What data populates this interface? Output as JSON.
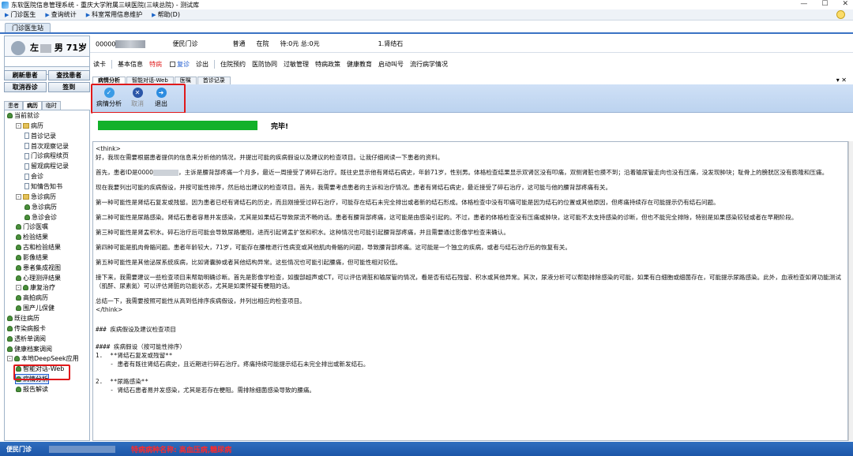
{
  "window": {
    "title": "东软医院信息管理系统 - 重庆大学附属三峡医院(三峡总院) - 测试库"
  },
  "menu": {
    "items": [
      "门诊医生",
      "查询统计",
      "科室常用信息维护",
      "帮助(D)"
    ]
  },
  "workspace_tab": "门诊医生站",
  "patient": {
    "surname": "左",
    "gender": "男",
    "age": "71岁"
  },
  "infobar": {
    "id_prefix": "00000",
    "clinic_type": "便民门诊",
    "level": "普通",
    "status": "在院",
    "balance": "待:0元 总:0元",
    "diagnosis": "1.肾结石"
  },
  "toolbar": {
    "items": [
      {
        "label": "读卡",
        "red": false
      },
      {
        "label": "基本信息",
        "red": false
      },
      {
        "label": "特病",
        "red": true
      }
    ],
    "recheck_label": "复诊",
    "rest": [
      "诊出",
      "住院预约",
      "医防协同",
      "过敏管理",
      "特病政策",
      "健康教育",
      "启动叫号",
      "流行病学情况"
    ]
  },
  "left": {
    "buttons": [
      "刷新患者",
      "查找患者",
      "取消吞诊",
      "签到"
    ],
    "tabs": [
      "患者",
      "病历",
      "临时"
    ],
    "tree": [
      {
        "label": "当前就诊",
        "lvl": 0,
        "icon": "person"
      },
      {
        "label": "病历",
        "lvl": 1,
        "icon": "folder",
        "exp": "-"
      },
      {
        "label": "首诊记录",
        "lvl": 2,
        "icon": "doc"
      },
      {
        "label": "首次观察记录",
        "lvl": 2,
        "icon": "doc"
      },
      {
        "label": "门诊病程续页",
        "lvl": 2,
        "icon": "doc"
      },
      {
        "label": "留观病程记录",
        "lvl": 2,
        "icon": "doc"
      },
      {
        "label": "会诊",
        "lvl": 2,
        "icon": "doc"
      },
      {
        "label": "知情告知书",
        "lvl": 2,
        "icon": "doc"
      },
      {
        "label": "急诊病历",
        "lvl": 1,
        "icon": "folder",
        "exp": "-"
      },
      {
        "label": "急诊病历",
        "lvl": 2,
        "icon": "person"
      },
      {
        "label": "急诊会诊",
        "lvl": 2,
        "icon": "person"
      },
      {
        "label": "门诊医嘱",
        "lvl": 1,
        "icon": "person"
      },
      {
        "label": "检验结果",
        "lvl": 1,
        "icon": "person"
      },
      {
        "label": "古和检验结果",
        "lvl": 1,
        "icon": "person"
      },
      {
        "label": "影像结果",
        "lvl": 1,
        "icon": "person"
      },
      {
        "label": "患者集成视图",
        "lvl": 1,
        "icon": "person"
      },
      {
        "label": "心理测评结果",
        "lvl": 1,
        "icon": "person"
      },
      {
        "label": "康复治疗",
        "lvl": 1,
        "icon": "person",
        "exp": "-"
      },
      {
        "label": "高拍病历",
        "lvl": 1,
        "icon": "person"
      },
      {
        "label": "围产儿保健",
        "lvl": 1,
        "icon": "person"
      },
      {
        "label": "既往病历",
        "lvl": 0,
        "icon": "person"
      },
      {
        "label": "传染病报卡",
        "lvl": 0,
        "icon": "person"
      },
      {
        "label": "透析单调阅",
        "lvl": 0,
        "icon": "person"
      },
      {
        "label": "健康档案调阅",
        "lvl": 0,
        "icon": "person"
      },
      {
        "label": "本地DeepSeek应用",
        "lvl": 0,
        "icon": "person",
        "exp": "-"
      },
      {
        "label": "智能对话-Web",
        "lvl": 1,
        "icon": "person"
      },
      {
        "label": "病情分析",
        "lvl": 1,
        "icon": "person",
        "sel": true
      },
      {
        "label": "报告解读",
        "lvl": 1,
        "icon": "person"
      }
    ]
  },
  "content": {
    "tabs": [
      "病情分析",
      "智能对话-Web",
      "医嘱",
      "首诊记录"
    ],
    "actions": [
      {
        "label": "病情分析",
        "icon": "check-icon",
        "color": "#3a9be6",
        "enabled": true
      },
      {
        "label": "取消",
        "icon": "cancel-icon",
        "color": "#2b56a8",
        "enabled": false
      },
      {
        "label": "退出",
        "icon": "exit-icon",
        "color": "#2c8ce0",
        "enabled": true
      }
    ],
    "progress": {
      "value": 1.0,
      "label": "完毕!"
    },
    "text": {
      "think_open": "<think>",
      "p1": "好，我现在需要根据患者提供的信息来分析他的情况，并提出可能的疾病假设以及建议的检查项目。让我仔细阅读一下患者的资料。",
      "p2a": "首先，患者ID是0000",
      "p2b": "，主诉是腰背部疼痛一个月多，最近一周接受了肾碎石治疗。既往史显示他有肾结石病史，年龄71岁，性别男。体格检查结果显示双肾区没有叩痛，双侧肾脏也摸不到；沿着输尿管走向也没有压痛，没发现肿块；耻骨上的膀胱区没有膨隆和压痛。",
      "p3": "现在我要列出可能的疾病假设，并按可能性排序，然后给出建议的检查项目。首先，我需要考虑患者的主诉和治疗情况。患者有肾结石病史，最近接受了碎石治疗，这可能与他的腰背部疼痛有关。",
      "p4": "第一种可能性是肾结石复发或残留。因为患者已经有肾结石的历史，而且刚接受过碎石治疗，可能存在结石未完全排出或者新的结石形成。体格检查中没有叩痛可能是因为结石的位置或其他原因，但疼痛持续存在可能提示仍有结石问题。",
      "p5": "第二种可能性是尿路感染。肾结石患者容易并发感染，尤其是如果结石导致尿流不畅的话。患者有腰背部疼痛，这可能是由感染引起的。不过，患者的体格检查没有压痛或肿块，这可能不太支持感染的诊断，但也不能完全排除，特别是如果感染较轻或者在早期阶段。",
      "p6": "第三种可能性是肾盂积水。碎石治疗后可能会导致尿路梗阻，进而引起肾盂扩张和积水。这种情况也可能引起腰背部疼痛，并且需要通过影像学检查来确认。",
      "p7": "第四种可能是肌肉骨骼问题。患者年龄较大，71岁，可能存在腰椎退行性病变或其他肌肉骨骼的问题，导致腰背部疼痛。这可能是一个独立的疾病，或者与结石治疗后的恢复有关。",
      "p8": "第五种可能性是其他泌尿系统疾病，比如肾囊肿或者其他结构异常。这些情况也可能引起腰痛，但可能性相对较低。",
      "p9": "接下来，我需要建议一些检查项目来帮助明确诊断。首先是影像学检查，如腹部超声或CT，可以评估肾脏和输尿管的情况，看是否有结石残留、积水或其他异常。其次，尿液分析可以帮助排除感染的可能，如果有白细胞或细菌存在，可能提示尿路感染。此外，血液检查如肾功能测试（肌酐、尿素氮）可以评估肾脏的功能状态，尤其是如果怀疑有梗阻的话。",
      "p10": "总结一下，我需要按照可能性从高到低排序疾病假设，并列出相应的检查项目。",
      "think_close": "</think>",
      "h3": "### 疾病假设及建议检查项目",
      "h4": "#### 疾病假设（按可能性排序）",
      "l1": "1.  **肾结石复发或残留**",
      "l1d": "    - 患者有既往肾结石病史，且近期进行碎石治疗。疼痛持续可能提示结石未完全排出或新发结石。",
      "l2": "2.  **尿路感染**",
      "l2d": "    - 肾结石患者易并发感染，尤其是若存在梗阻。需排除细菌感染导致的腰痛。"
    }
  },
  "status": {
    "left": "便民门诊",
    "alert": "特病病种名称: 高血压病,糖尿病"
  }
}
